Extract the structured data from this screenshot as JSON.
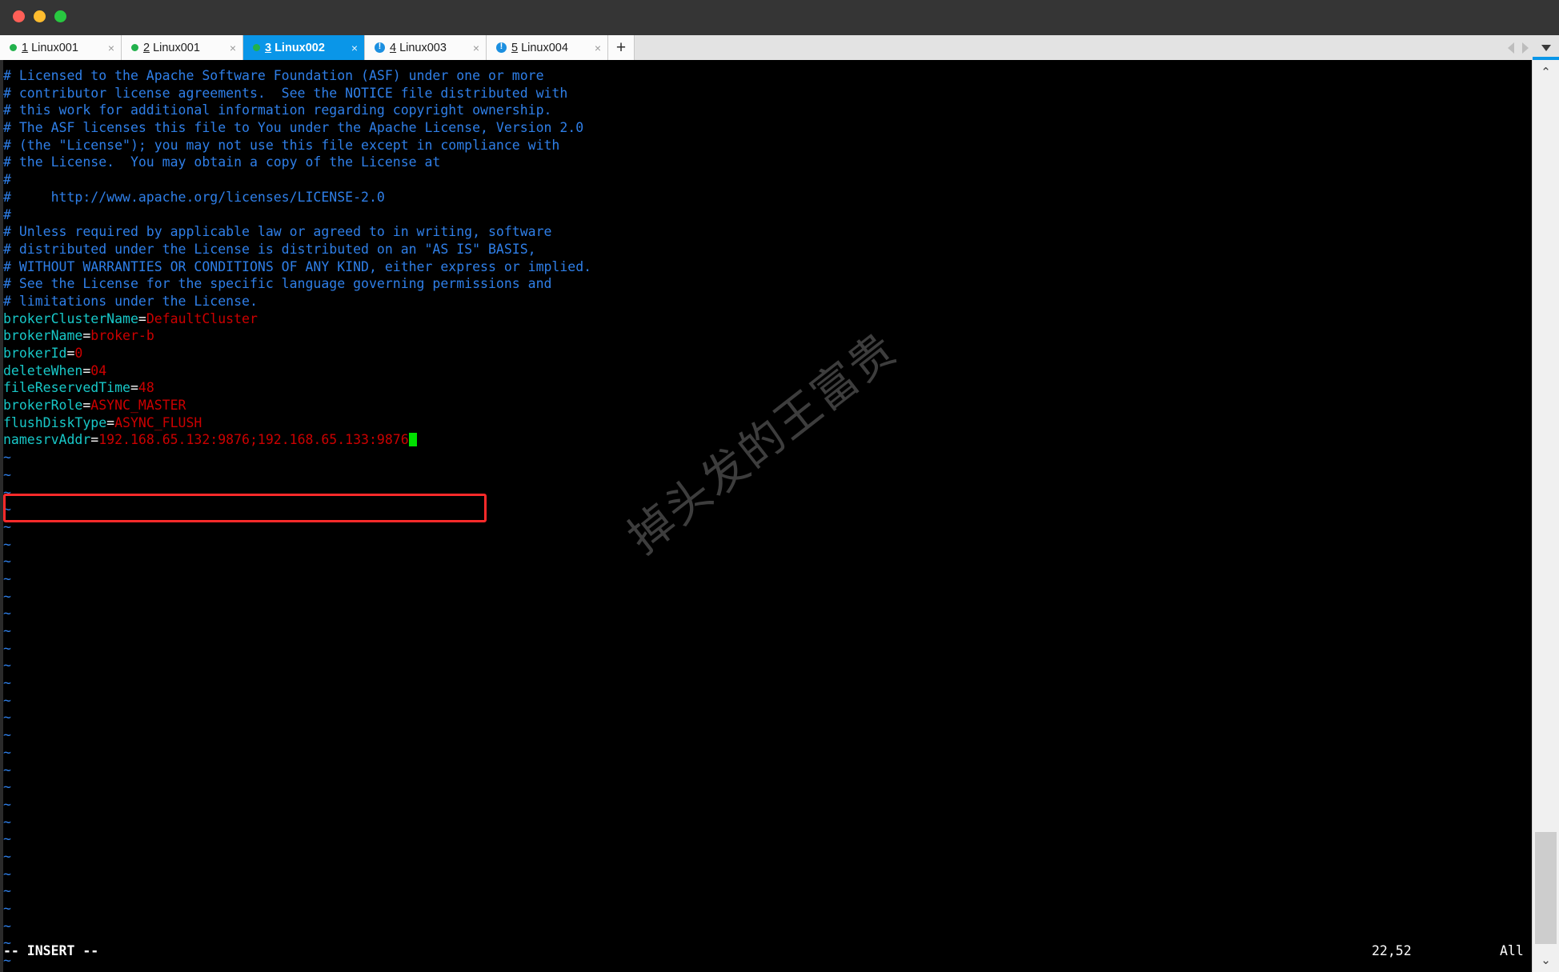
{
  "window": {
    "controls": [
      {
        "name": "close",
        "color": "#ff5f57"
      },
      {
        "name": "minimize",
        "color": "#febc2e"
      },
      {
        "name": "maximize",
        "color": "#28c840"
      }
    ]
  },
  "tabstrip": {
    "tabs": [
      {
        "index": "1",
        "label": "Linux001",
        "status": "connected",
        "active": false,
        "close": "×"
      },
      {
        "index": "2",
        "label": "Linux001",
        "status": "connected",
        "active": false,
        "close": "×"
      },
      {
        "index": "3",
        "label": "Linux002",
        "status": "connected",
        "active": true,
        "close": "×"
      },
      {
        "index": "4",
        "label": "Linux003",
        "status": "info",
        "active": false,
        "close": "×"
      },
      {
        "index": "5",
        "label": "Linux004",
        "status": "info",
        "active": false,
        "close": "×"
      }
    ],
    "add_label": "+",
    "nav": {
      "prev": "prev-tab-arrow",
      "next": "next-tab-arrow",
      "list": "tab-list-chevron"
    }
  },
  "terminal": {
    "lines": [
      {
        "type": "comment",
        "text": "# Licensed to the Apache Software Foundation (ASF) under one or more"
      },
      {
        "type": "comment",
        "text": "# contributor license agreements.  See the NOTICE file distributed with"
      },
      {
        "type": "comment",
        "text": "# this work for additional information regarding copyright ownership."
      },
      {
        "type": "comment",
        "text": "# The ASF licenses this file to You under the Apache License, Version 2.0"
      },
      {
        "type": "comment",
        "text": "# (the \"License\"); you may not use this file except in compliance with"
      },
      {
        "type": "comment",
        "text": "# the License.  You may obtain a copy of the License at"
      },
      {
        "type": "comment",
        "text": "#"
      },
      {
        "type": "comment",
        "text": "#     http://www.apache.org/licenses/LICENSE-2.0"
      },
      {
        "type": "comment",
        "text": "#"
      },
      {
        "type": "comment",
        "text": "# Unless required by applicable law or agreed to in writing, software"
      },
      {
        "type": "comment",
        "text": "# distributed under the License is distributed on an \"AS IS\" BASIS,"
      },
      {
        "type": "comment",
        "text": "# WITHOUT WARRANTIES OR CONDITIONS OF ANY KIND, either express or implied."
      },
      {
        "type": "comment",
        "text": "# See the License for the specific language governing permissions and"
      },
      {
        "type": "comment",
        "text": "# limitations under the License."
      },
      {
        "type": "kv",
        "key": "brokerClusterName",
        "value": "DefaultCluster"
      },
      {
        "type": "kv",
        "key": "brokerName",
        "value": "broker-b"
      },
      {
        "type": "kv",
        "key": "brokerId",
        "value": "0"
      },
      {
        "type": "kv",
        "key": "deleteWhen",
        "value": "04"
      },
      {
        "type": "kv",
        "key": "fileReservedTime",
        "value": "48"
      },
      {
        "type": "kv",
        "key": "brokerRole",
        "value": "ASYNC_MASTER"
      },
      {
        "type": "kv",
        "key": "flushDiskType",
        "value": "ASYNC_FLUSH"
      },
      {
        "type": "kv",
        "key": "namesrvAddr",
        "value": "192.168.65.132:9876;192.168.65.133:9876",
        "cursor": true,
        "highlighted": true
      }
    ],
    "empty_marker": "~",
    "empty_line_count": 30
  },
  "annotation": {
    "kind": "red-rectangle-highlight",
    "color": "#ff2a2a",
    "targets_line": "namesrvAddr=192.168.65.132:9876;192.168.65.133:9876"
  },
  "watermark": {
    "text": "掉头发的王富贵",
    "color": "#3d3d3d"
  },
  "statusline": {
    "mode": "-- INSERT --",
    "position": "22,52",
    "scroll": "All"
  },
  "scrollbar": {
    "up": "⌃",
    "down": "⌄"
  }
}
